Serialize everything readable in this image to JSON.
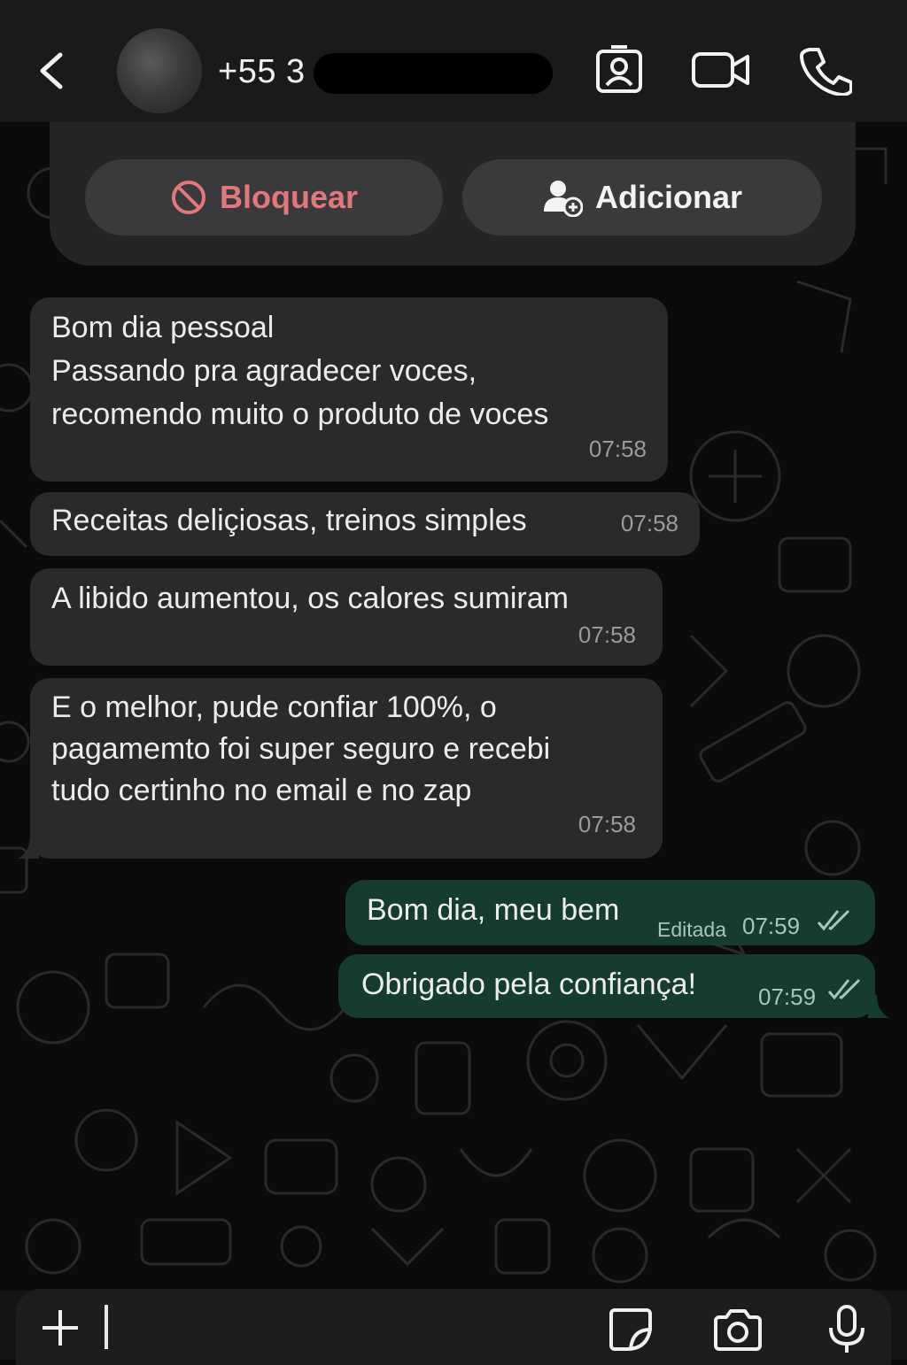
{
  "header": {
    "contact_name": "+55 3",
    "icons": [
      "back-chevron-icon",
      "contact-card-icon",
      "video-call-icon",
      "phone-call-icon"
    ]
  },
  "contact_card": {
    "block_label": "Bloquear",
    "add_label": "Adicionar"
  },
  "messages": [
    {
      "direction": "in",
      "text": "Bom dia pessoal\nPassando pra agradecer voces,\nrecomendo muito o produto de voces",
      "time": "07:58"
    },
    {
      "direction": "in",
      "text": "Receitas deliçiosas, treinos simples",
      "time": "07:58"
    },
    {
      "direction": "in",
      "text": "A libido aumentou, os calores sumiram",
      "time": "07:58"
    },
    {
      "direction": "in",
      "text": "E o melhor, pude confiar 100%, o\npagamemto foi super seguro e recebi\ntudo certinho no email e no zap",
      "time": "07:58"
    },
    {
      "direction": "out",
      "text": "Bom dia, meu bem",
      "edited": "Editada",
      "time": "07:59",
      "status": "read"
    },
    {
      "direction": "out",
      "text": "Obrigado pela confiança!",
      "time": "07:59",
      "status": "read"
    }
  ],
  "input_bar": {
    "value": "",
    "icons": [
      "plus-icon",
      "sticker-icon",
      "camera-icon",
      "microphone-icon"
    ]
  },
  "colors": {
    "incoming_bubble": "#2a2a2b",
    "outgoing_bubble": "#163b31",
    "block_text": "#e0787c",
    "header_bg": "#1a1a1a"
  }
}
